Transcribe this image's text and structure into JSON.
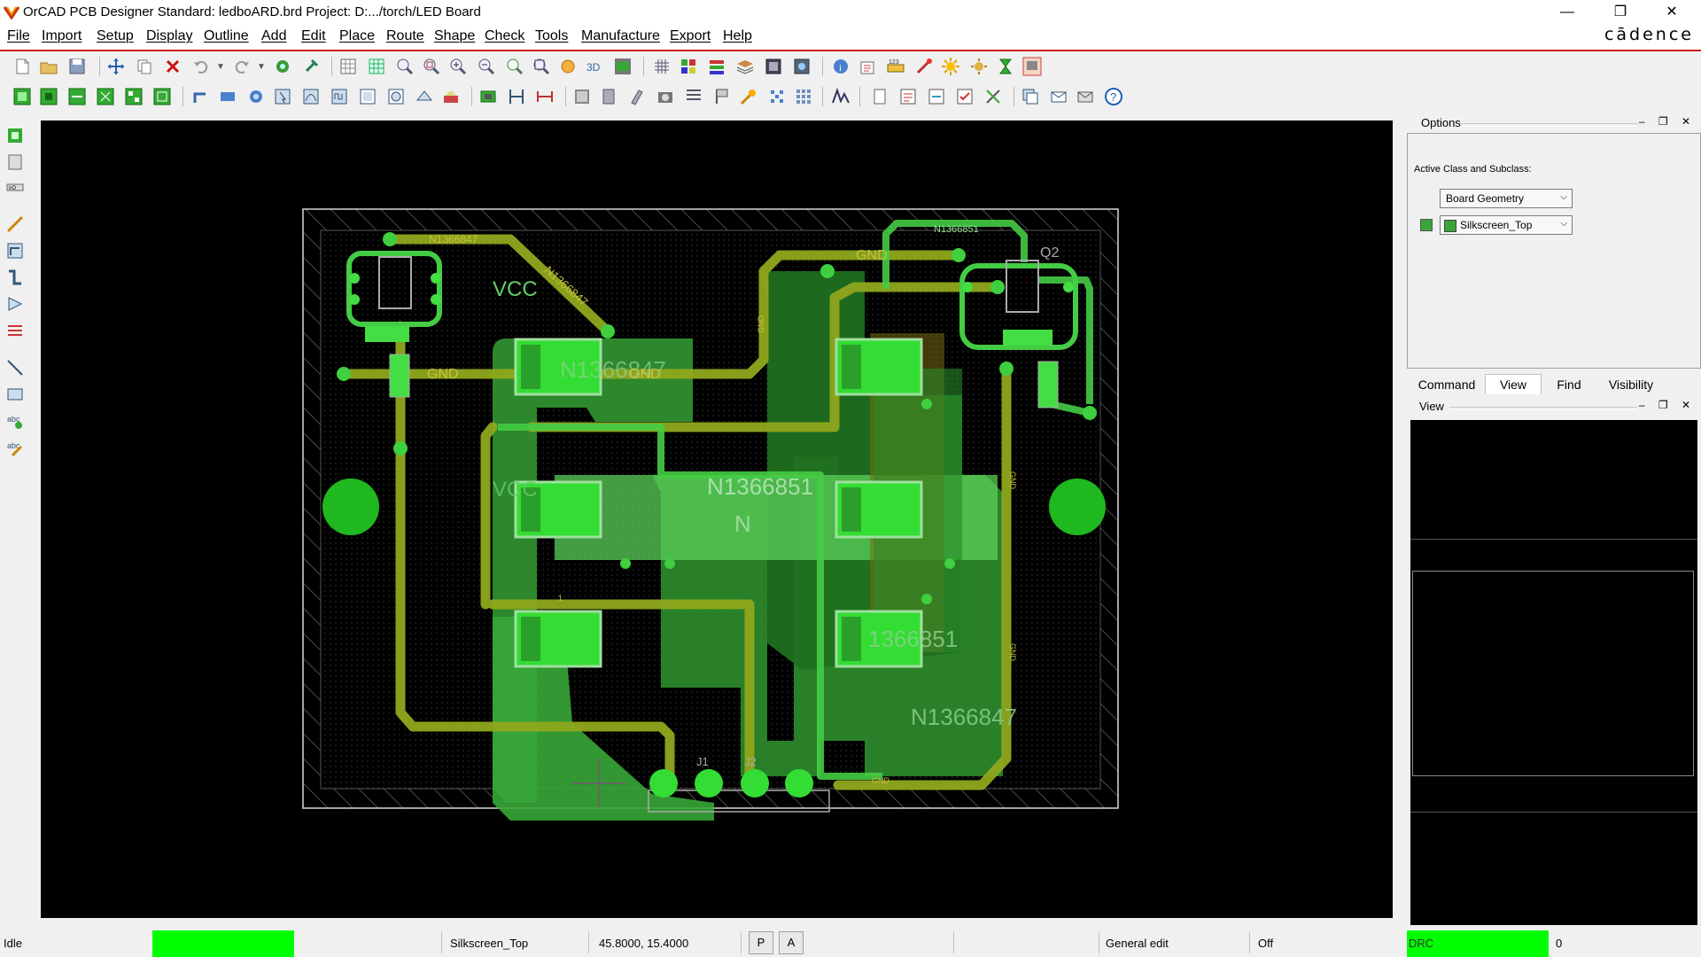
{
  "window": {
    "title": "OrCAD PCB Designer Standard: ledboARD.brd  Project: D:.../torch/LED Board",
    "minimize": "—",
    "maximize": "❐",
    "close": "✕"
  },
  "menu": [
    "File",
    "Import",
    "Setup",
    "Display",
    "Outline",
    "Add",
    "Edit",
    "Place",
    "Route",
    "Shape",
    "Check",
    "Tools",
    "Manufacture",
    "Export",
    "Help"
  ],
  "brand": "cādence",
  "options_panel": {
    "title": "Options",
    "active_class_label": "Active Class and Subclass:",
    "class_value": "Board Geometry",
    "subclass_value": "Silkscreen_Top",
    "subclass_color": "#3aa63a"
  },
  "tabs": [
    {
      "label": "Command",
      "active": false
    },
    {
      "label": "View",
      "active": true
    },
    {
      "label": "Find",
      "active": false
    },
    {
      "label": "Visibility",
      "active": false
    }
  ],
  "view_panel": {
    "title": "View"
  },
  "pcb": {
    "labels": {
      "n1366847_top": "N1366847",
      "n1366847_diag": "N1366847",
      "n1366847_pad": "N1366847",
      "n1366847_bottom": "N1366847",
      "n1366851_top": "N1366851",
      "n1366851_center": "N1366851",
      "n1366851_pad": "1366851",
      "n_frag": "N",
      "vcc1": "VCC",
      "vcc2": "VCC",
      "gnd_left": "GND",
      "gnd_mid": "GND",
      "gnd_top": "GND",
      "q2": "Q2",
      "gnd_small1": "GND",
      "gnd_small2": "GND",
      "gnd_small3": "GND",
      "gnd_small4": "GND",
      "j1": "J1",
      "j2": "J2",
      "one": "1"
    },
    "colors": {
      "copper_shape": "#2f9a2f",
      "copper_pour": "#3cc43c",
      "trace_top": "#8fa81c",
      "pad": "#33dd33",
      "outline": "#d8d8d8",
      "hatch": "#4a4a4a"
    }
  },
  "status": {
    "state": "Idle",
    "indicator_color": "#00ff00",
    "subclass": "Silkscreen_Top",
    "coords": "45.8000, 15.4000",
    "p_btn": "P",
    "a_btn": "A",
    "mode": "General edit",
    "off": "Off",
    "drc": "DRC",
    "drc_count": "0"
  }
}
